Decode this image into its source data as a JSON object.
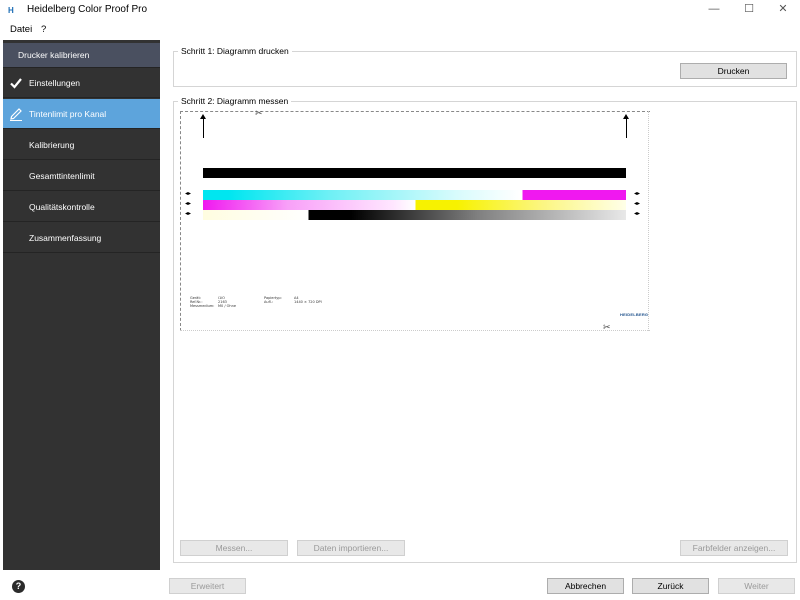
{
  "window": {
    "logo_text": "H",
    "title": "Heidelberg Color Proof Pro",
    "minimize": "—",
    "maximize": "☐",
    "close": "✕"
  },
  "menu": {
    "file": "Datei",
    "help": "?"
  },
  "sidebar": {
    "header": "Drucker kalibrieren",
    "items": [
      {
        "label": "Einstellungen",
        "state": "done",
        "icon": "checkmark-icon"
      },
      {
        "label": "Tintenlimit pro Kanal",
        "state": "active",
        "icon": "pencil-icon"
      },
      {
        "label": "Kalibrierung",
        "state": "pending",
        "icon": ""
      },
      {
        "label": "Gesamttintenlimit",
        "state": "pending",
        "icon": ""
      },
      {
        "label": "Qualitätskontrolle",
        "state": "pending",
        "icon": ""
      },
      {
        "label": "Zusammenfassung",
        "state": "pending",
        "icon": ""
      }
    ],
    "colors": {
      "background": "#323232",
      "header": "#4a5060",
      "active": "#5da4dc"
    }
  },
  "step1": {
    "title": "Schritt 1: Diagramm drucken",
    "print_button": "Drucken"
  },
  "step2": {
    "title": "Schritt 2: Diagramm messen",
    "measure_button": "Messen...",
    "import_button": "Daten importieren...",
    "show_patches_button": "Farbfelder anzeigen...",
    "chart_preview": {
      "brand": "HEIDELBERG",
      "strip_colors": {
        "cyan": "#00e6f0",
        "magenta": "#f018f0",
        "yellow": "#f7f200",
        "black": "#000000"
      },
      "meta_left": [
        "Gerät:",
        "Ref.Nr.:",
        "Messmedium:"
      ],
      "meta_left_vals": [
        "i1iO",
        "2163",
        "M0 / Ohne"
      ],
      "meta_right": [
        "Papiertyp:",
        "Aufl.:"
      ],
      "meta_right_vals": [
        "A4",
        "1440 × 720 DPI"
      ]
    }
  },
  "footer": {
    "help": "?",
    "advanced_button": "Erweitert",
    "cancel_button": "Abbrechen",
    "back_button": "Zurück",
    "next_button": "Weiter"
  }
}
